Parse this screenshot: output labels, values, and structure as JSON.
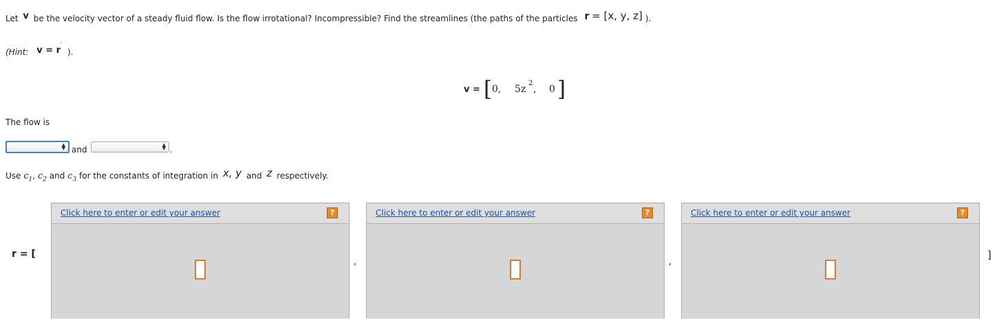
{
  "question": {
    "line1_let": "Let",
    "line1_v": "v",
    "line1_text": "be the velocity vector of a steady fluid flow. Is the flow irrotational? Incompressible? Find the streamlines (the paths of the particles",
    "line1_r": "r",
    "line1_eq": "= [x, y, z]",
    "line1_end": ").",
    "hint_open": "(Hint:",
    "hint_formula": "v = r",
    "hint_prime": "′",
    "hint_close": ")."
  },
  "equation": {
    "lhs": "v =",
    "entries": [
      "0,",
      "5z",
      "2",
      ",",
      "0"
    ]
  },
  "flow": {
    "label": "The flow is",
    "select1_value": "",
    "and_text": "and",
    "select2_value": "",
    "period": "."
  },
  "instructions": {
    "use": "Use",
    "c": "c",
    "sub1": "1",
    "sub2": "2",
    "sub3": "3",
    "comma": ",",
    "and1": "and",
    "for_text": "for the constants of integration in",
    "xy": "x, y",
    "and2": "and",
    "z": "z",
    "respectively": "respectively."
  },
  "result": {
    "lhs": "r = [",
    "sep": ",",
    "close": "]"
  },
  "answers": [
    {
      "link": "Click here to enter or edit your answer",
      "help": "?"
    },
    {
      "link": "Click here to enter or edit your answer",
      "help": "?"
    },
    {
      "link": "Click here to enter or edit your answer",
      "help": "?"
    }
  ],
  "colors": {
    "link": "#1a4fb3",
    "help_button": "#e8892a",
    "answer_box_border": "#e07a2a",
    "focus_border": "#3b82d6",
    "panel_bg": "#d4d6d8"
  }
}
